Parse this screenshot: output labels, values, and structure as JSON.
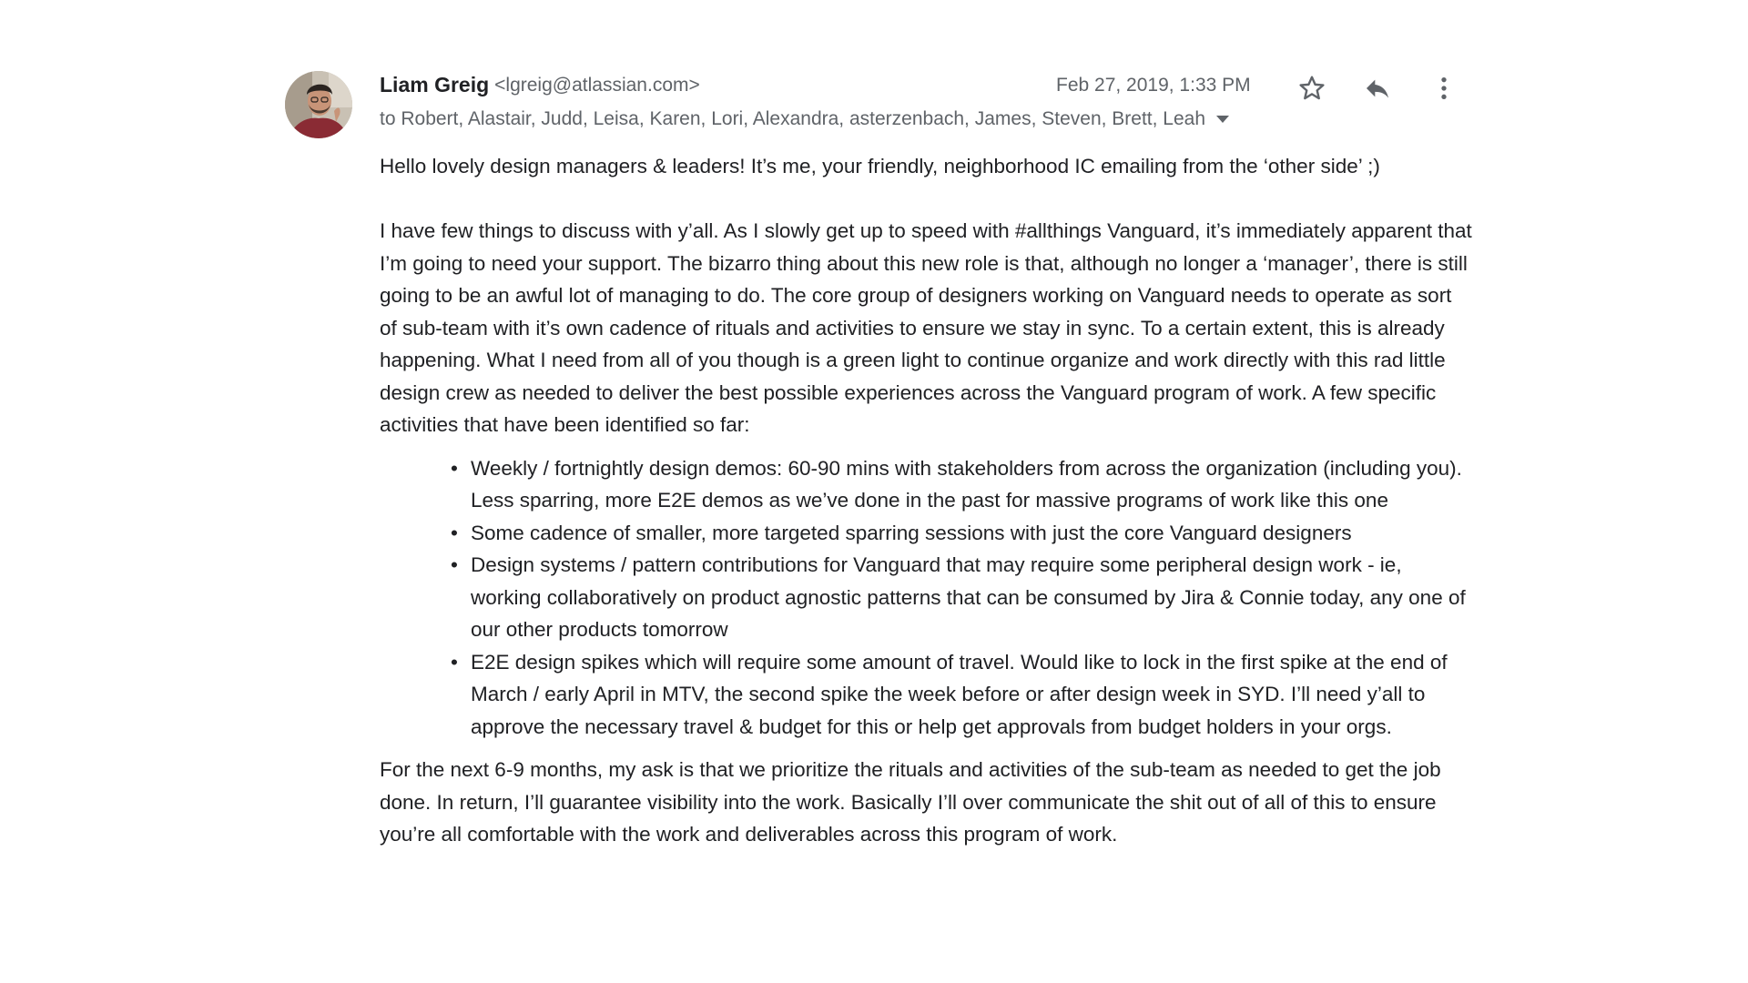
{
  "sender": {
    "name": "Liam Greig",
    "email": "<lgreig@atlassian.com>"
  },
  "timestamp": "Feb 27, 2019, 1:33 PM",
  "recipients": "to Robert, Alastair, Judd, Leisa, Karen, Lori, Alexandra, asterzenbach, James, Steven, Brett, Leah",
  "icons": {
    "star": "star-icon",
    "reply": "reply-icon",
    "more": "more-vert-icon",
    "caret": "caret-down-icon"
  },
  "body": {
    "greeting": "Hello lovely design managers & leaders! It’s me, your friendly, neighborhood IC emailing from the ‘other side’ ;)",
    "intro": "I have few things to discuss with y’all. As I slowly get up to speed with #allthings Vanguard, it’s immediately apparent that I’m going to need your support. The bizarro thing about this new role is that, although no longer a ‘manager’, there is still going to be an awful lot of managing to do. The core group of designers working on Vanguard needs to operate as sort of sub-team with it’s own cadence of rituals and activities to ensure we stay in sync. To a certain extent, this is already happening. What I need from all of you though is a green light to continue organize and work directly with this rad little design crew as needed to deliver the best possible experiences across the Vanguard program of work. A few specific activities that have been identified so far:",
    "bullets": [
      "Weekly / fortnightly design demos: 60-90 mins with stakeholders from across the organization (including you). Less sparring, more E2E demos as we’ve done in the past for massive programs of work like this one",
      "Some cadence of smaller, more targeted sparring sessions with just the core Vanguard designers",
      "Design systems / pattern contributions for Vanguard that may require some peripheral design work - ie, working collaboratively on product agnostic patterns that can be consumed by Jira & Connie today, any one of our other products tomorrow",
      "E2E design spikes which will require some amount of travel. Would like to lock in the first spike at the end of March / early April in MTV, the second spike the week before or after design week in SYD. I’ll need y’all to approve the necessary travel & budget for this or help get approvals from budget holders in your orgs."
    ],
    "closing": "For the next 6-9 months, my ask is that we prioritize the rituals and activities of the sub-team as needed to get the job done. In return, I’ll guarantee visibility into the work. Basically I’ll over communicate the shit out of all of this to ensure you’re all comfortable with the work and deliverables across this program of work."
  }
}
